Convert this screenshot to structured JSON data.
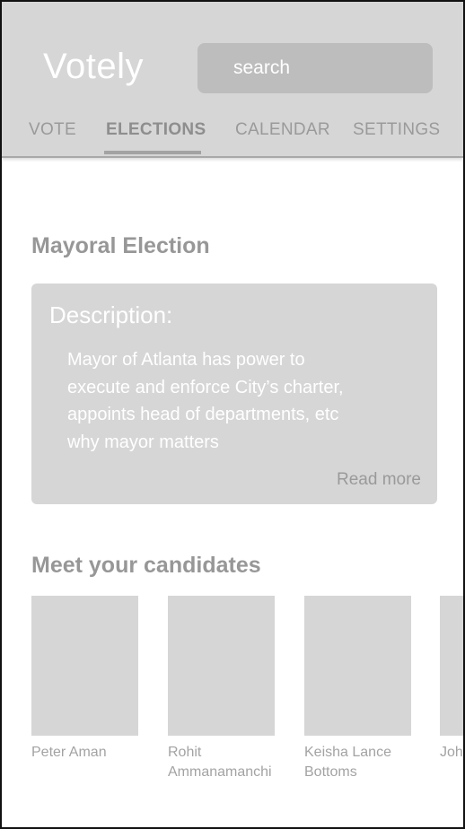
{
  "app": {
    "title": "Votely"
  },
  "search": {
    "placeholder": "search"
  },
  "tabs": [
    {
      "label": "VOTE",
      "active": false
    },
    {
      "label": "ELECTIONS",
      "active": true
    },
    {
      "label": "CALENDAR",
      "active": false
    },
    {
      "label": "SETTINGS",
      "active": false
    }
  ],
  "election": {
    "title": "Mayoral Election",
    "description_heading": "Description:",
    "description_body": "Mayor of Atlanta has power to execute and enforce City’s charter, appoints head of departments, etc why mayor matters",
    "read_more": "Read more"
  },
  "candidates": {
    "title": "Meet your candidates",
    "items": [
      {
        "name": "Peter Aman"
      },
      {
        "name": "Rohit Ammanamanchi"
      },
      {
        "name": "Keisha Lance Bottoms"
      },
      {
        "name": "Joh"
      }
    ]
  },
  "colors": {
    "header_bg": "#d6d6d6",
    "search_bg": "#bdbdbd",
    "card_bg": "#d6d6d6",
    "muted_text": "#979797"
  }
}
